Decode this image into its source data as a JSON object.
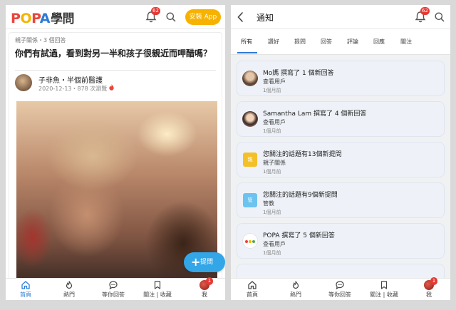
{
  "left": {
    "logo": {
      "latin": "POPA",
      "chinese": "學問"
    },
    "notification_count": "62",
    "install_label": "安裝 App",
    "post": {
      "meta": "親子關係・3 個回答",
      "title": "你們有試過，看到對另一半和孩子很親近而呷醋嗎？",
      "author": "子非魚・半個前醫護",
      "date_views": "2020-12-13・878 次瀏覽"
    },
    "fab_label": "提問",
    "nav": [
      {
        "label": "首頁",
        "icon": "home-icon"
      },
      {
        "label": "熱門",
        "icon": "fire-icon"
      },
      {
        "label": "等你回答",
        "icon": "chat-icon"
      },
      {
        "label": "關注 | 收藏",
        "icon": "bookmark-icon"
      },
      {
        "label": "我",
        "icon": "avatar"
      }
    ],
    "me_badge": "1"
  },
  "right": {
    "title": "通知",
    "notification_count": "62",
    "tabs": [
      "所有",
      "讚好",
      "提問",
      "回答",
      "評論",
      "回應",
      "關注"
    ],
    "notifications": [
      {
        "text": "Mo媽 撰寫了 1 個新回答",
        "sub": "查看用戶",
        "time": "1個月前",
        "avatar": "photo"
      },
      {
        "text": "Samantha Lam 撰寫了 4 個新回答",
        "sub": "查看用戶",
        "time": "1個月前",
        "avatar": "photo"
      },
      {
        "text": "您關注的話題有13個新提問",
        "sub": "親子關係",
        "time": "1個月前",
        "avatar_text": "親",
        "avatar_color": "#f4c02a"
      },
      {
        "text": "您關注的話題有9個新提問",
        "sub": "管教",
        "time": "1個月前",
        "avatar_text": "管",
        "avatar_color": "#6cc3ef"
      },
      {
        "text": "POPA 撰寫了 5 個新回答",
        "sub": "查看用戶",
        "time": "1個月前",
        "avatar": "popa-logo"
      }
    ],
    "nav": [
      {
        "label": "首頁",
        "icon": "home-icon"
      },
      {
        "label": "熱門",
        "icon": "fire-icon"
      },
      {
        "label": "等你回答",
        "icon": "chat-icon"
      },
      {
        "label": "關注 | 收藏",
        "icon": "bookmark-icon"
      },
      {
        "label": "我",
        "icon": "avatar"
      }
    ],
    "me_badge": "1"
  },
  "colors": {
    "accent": "#2e7bd6",
    "install": "#f7b200",
    "fab": "#33a6e8",
    "badge": "#e53935"
  }
}
